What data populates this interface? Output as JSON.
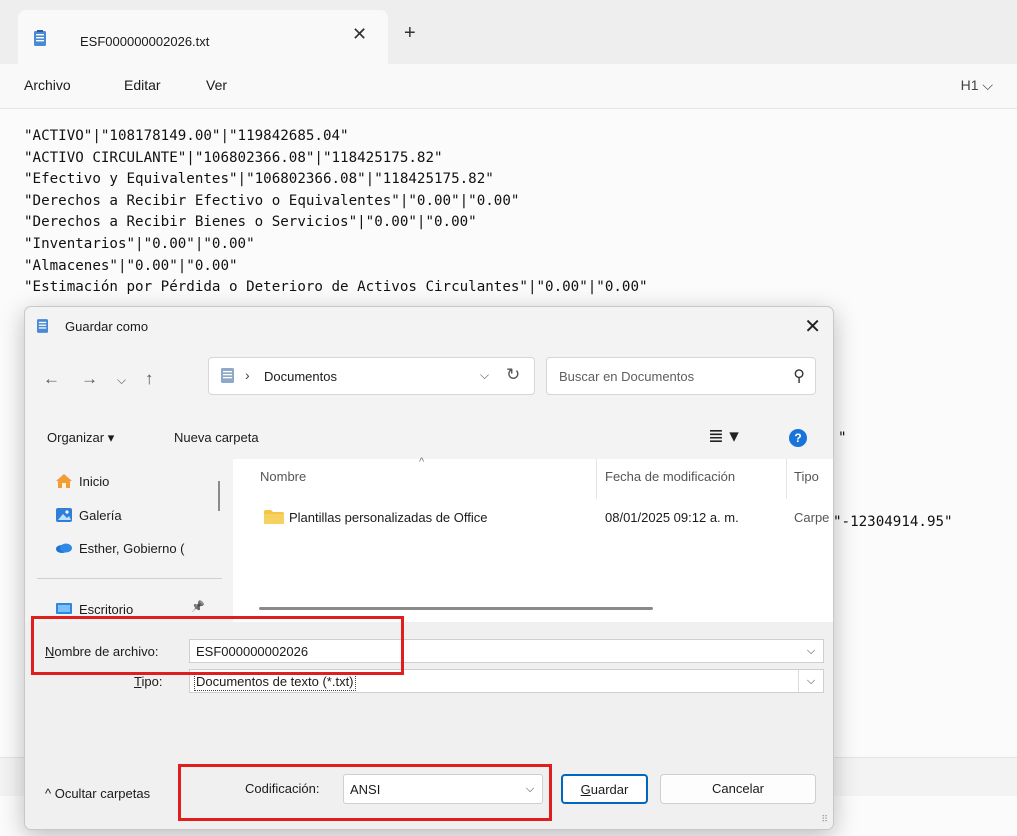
{
  "notepad": {
    "tab_title": "ESF000000002026.txt",
    "tab_close": "✕",
    "new_tab": "+",
    "menu": [
      "Archivo",
      "Editar",
      "Ver"
    ],
    "heading_selector": "H1 ⌵",
    "lines": [
      "\"ACTIVO\"|\"108178149.00\"|\"119842685.04\"",
      "\"ACTIVO CIRCULANTE\"|\"106802366.08\"|\"118425175.82\"",
      "\"Efectivo y Equivalentes\"|\"106802366.08\"|\"118425175.82\"",
      "\"Derechos a Recibir Efectivo o Equivalentes\"|\"0.00\"|\"0.00\"",
      "\"Derechos a Recibir Bienes o Servicios\"|\"0.00\"|\"0.00\"",
      "\"Inventarios\"|\"0.00\"|\"0.00\"",
      "\"Almacenes\"|\"0.00\"|\"0.00\"",
      "\"Estimación por Pérdida o Deterioro de Activos Circulantes\"|\"0.00\"|\"0.00\""
    ],
    "peek_text_1": "\"",
    "peek_text_2": "\"-12304914.95\""
  },
  "dialog": {
    "title": "Guardar como",
    "close": "✕",
    "nav": {
      "back": "←",
      "forward": "→",
      "recent": "⌵",
      "up": "↑"
    },
    "address": {
      "separator": "›",
      "path": "Documentos",
      "dropdown": "⌵",
      "refresh": "↻"
    },
    "search": {
      "placeholder": "Buscar en Documentos",
      "icon": "⚲"
    },
    "toolbar": {
      "organize": "Organizar ▾",
      "new_folder": "Nueva carpeta",
      "view": "≣ ▾",
      "help": "?"
    },
    "nav_items": [
      {
        "label": "Inicio",
        "icon": "home-icon"
      },
      {
        "label": "Galería",
        "icon": "gallery-icon"
      },
      {
        "label": "Esther, Gobierno (",
        "icon": "cloud-icon"
      },
      {
        "label": "Escritorio",
        "icon": "desktop-icon"
      }
    ],
    "pin_icon": "📌",
    "columns": {
      "name": "Nombre",
      "date": "Fecha de modificación",
      "type": "Tipo",
      "sort": "^"
    },
    "files": [
      {
        "name": "Plantillas personalizadas de Office",
        "date": "08/01/2025 09:12 a. m.",
        "type": "Carpe"
      }
    ],
    "filename_label": {
      "underlined": "N",
      "rest": "ombre de archivo:"
    },
    "filename_value": "ESF000000002026",
    "type_label": {
      "underlined": "T",
      "rest": "ipo:"
    },
    "type_value": "Documentos de texto (*.txt)",
    "chevron": "⌵",
    "hide_folders": "^  Ocultar carpetas",
    "encoding_label": "Codificación:",
    "encoding_value": "ANSI",
    "save": {
      "underlined": "G",
      "rest": "uardar"
    },
    "cancel": "Cancelar",
    "grip": "⠿"
  },
  "colors": {
    "accent": "#0067c0",
    "highlight": "#e01e1e",
    "folder": "#f4c542",
    "help": "#1a73d9"
  }
}
